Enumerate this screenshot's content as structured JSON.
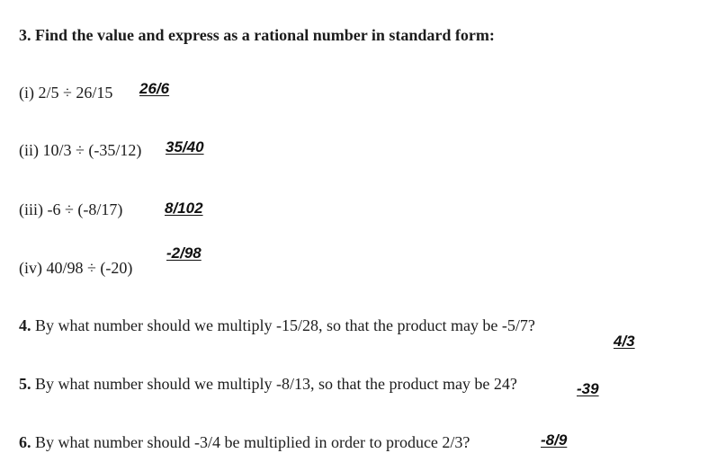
{
  "q3": {
    "title": "3. Find the value and express as a rational number in standard form:",
    "parts": [
      {
        "question": "(i) 2/5 ÷ 26/15",
        "answer": "26/6"
      },
      {
        "question": "(ii) 10/3 ÷ (-35/12)",
        "answer": "35/40"
      },
      {
        "question": "(iii) -6 ÷ (-8/17)",
        "answer": "8/102"
      },
      {
        "question": "(iv) 40/98 ÷ (-20)",
        "answer": "-2/98"
      }
    ]
  },
  "q4": {
    "number": "4.",
    "text": "By what number should we multiply -15/28, so that the product may be -5/7?",
    "answer": "4/3"
  },
  "q5": {
    "number": "5.",
    "text": "By what number should we multiply -8/13, so that the product may be 24?",
    "answer": "-39"
  },
  "q6": {
    "number": "6.",
    "text": "By what number should -3/4 be multiplied in order to produce 2/3?",
    "answer": "-8/9"
  }
}
